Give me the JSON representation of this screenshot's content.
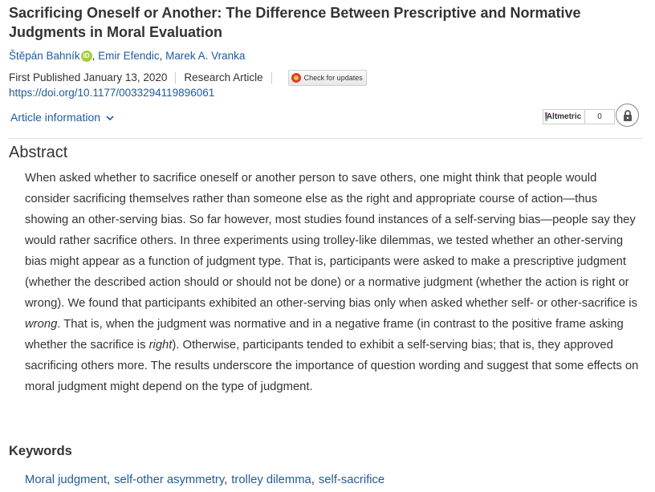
{
  "article": {
    "title": "Sacrificing Oneself or Another: The Difference Between Prescriptive and Normative Judgments in Moral Evaluation",
    "authors": [
      "Štěpán Bahník",
      "Emir Efendic",
      "Marek A. Vranka"
    ],
    "author_sep": ", ",
    "orcid_badge": "iD",
    "first_published": "First Published January 13, 2020",
    "article_type": "Research Article",
    "check_updates_label": "Check for updates",
    "doi": "https://doi.org/10.1177/0033294119896061",
    "article_info_label": "Article information",
    "altmetric_label": "Altmetric",
    "altmetric_score": "0"
  },
  "abstract": {
    "heading": "Abstract",
    "text_1": "When asked whether to sacrifice oneself or another person to save others, one might think that people would consider sacrificing themselves rather than someone else as the right and appropriate course of action—thus showing an other-serving bias. So far however, most studies found instances of a self-serving bias—people say they would rather sacrifice others. In three experiments using trolley-like dilemmas, we tested whether an other-serving bias might appear as a function of judgment type. That is, participants were asked to make a prescriptive judgment (whether the described action should or should not be done) or a normative judgment (whether the action is right or wrong). We found that participants exhibited an other-serving bias only when asked whether self- or other-sacrifice is ",
    "emph_1": "wrong",
    "text_2": ". That is, when the judgment was normative and in a negative frame (in contrast to the positive frame asking whether the sacrifice is ",
    "emph_2": "right",
    "text_3": "). Otherwise, participants tended to exhibit a self-serving bias; that is, they approved sacrificing others more. The results underscore the importance of question wording and suggest that some effects on moral judgment might depend on the type of judgment."
  },
  "keywords": {
    "heading": "Keywords",
    "items": [
      "Moral judgment",
      "self-other asymmetry",
      "trolley dilemma",
      "self-sacrifice"
    ],
    "sep": ","
  },
  "colors": {
    "link": "#1e5aa8",
    "text": "#333333",
    "orcid": "#a6ce39"
  },
  "icons": {
    "orcid": "orcid-icon",
    "lock": "lock-icon",
    "chevron": "chevron-down-icon",
    "check_updates": "crossmark-icon"
  }
}
